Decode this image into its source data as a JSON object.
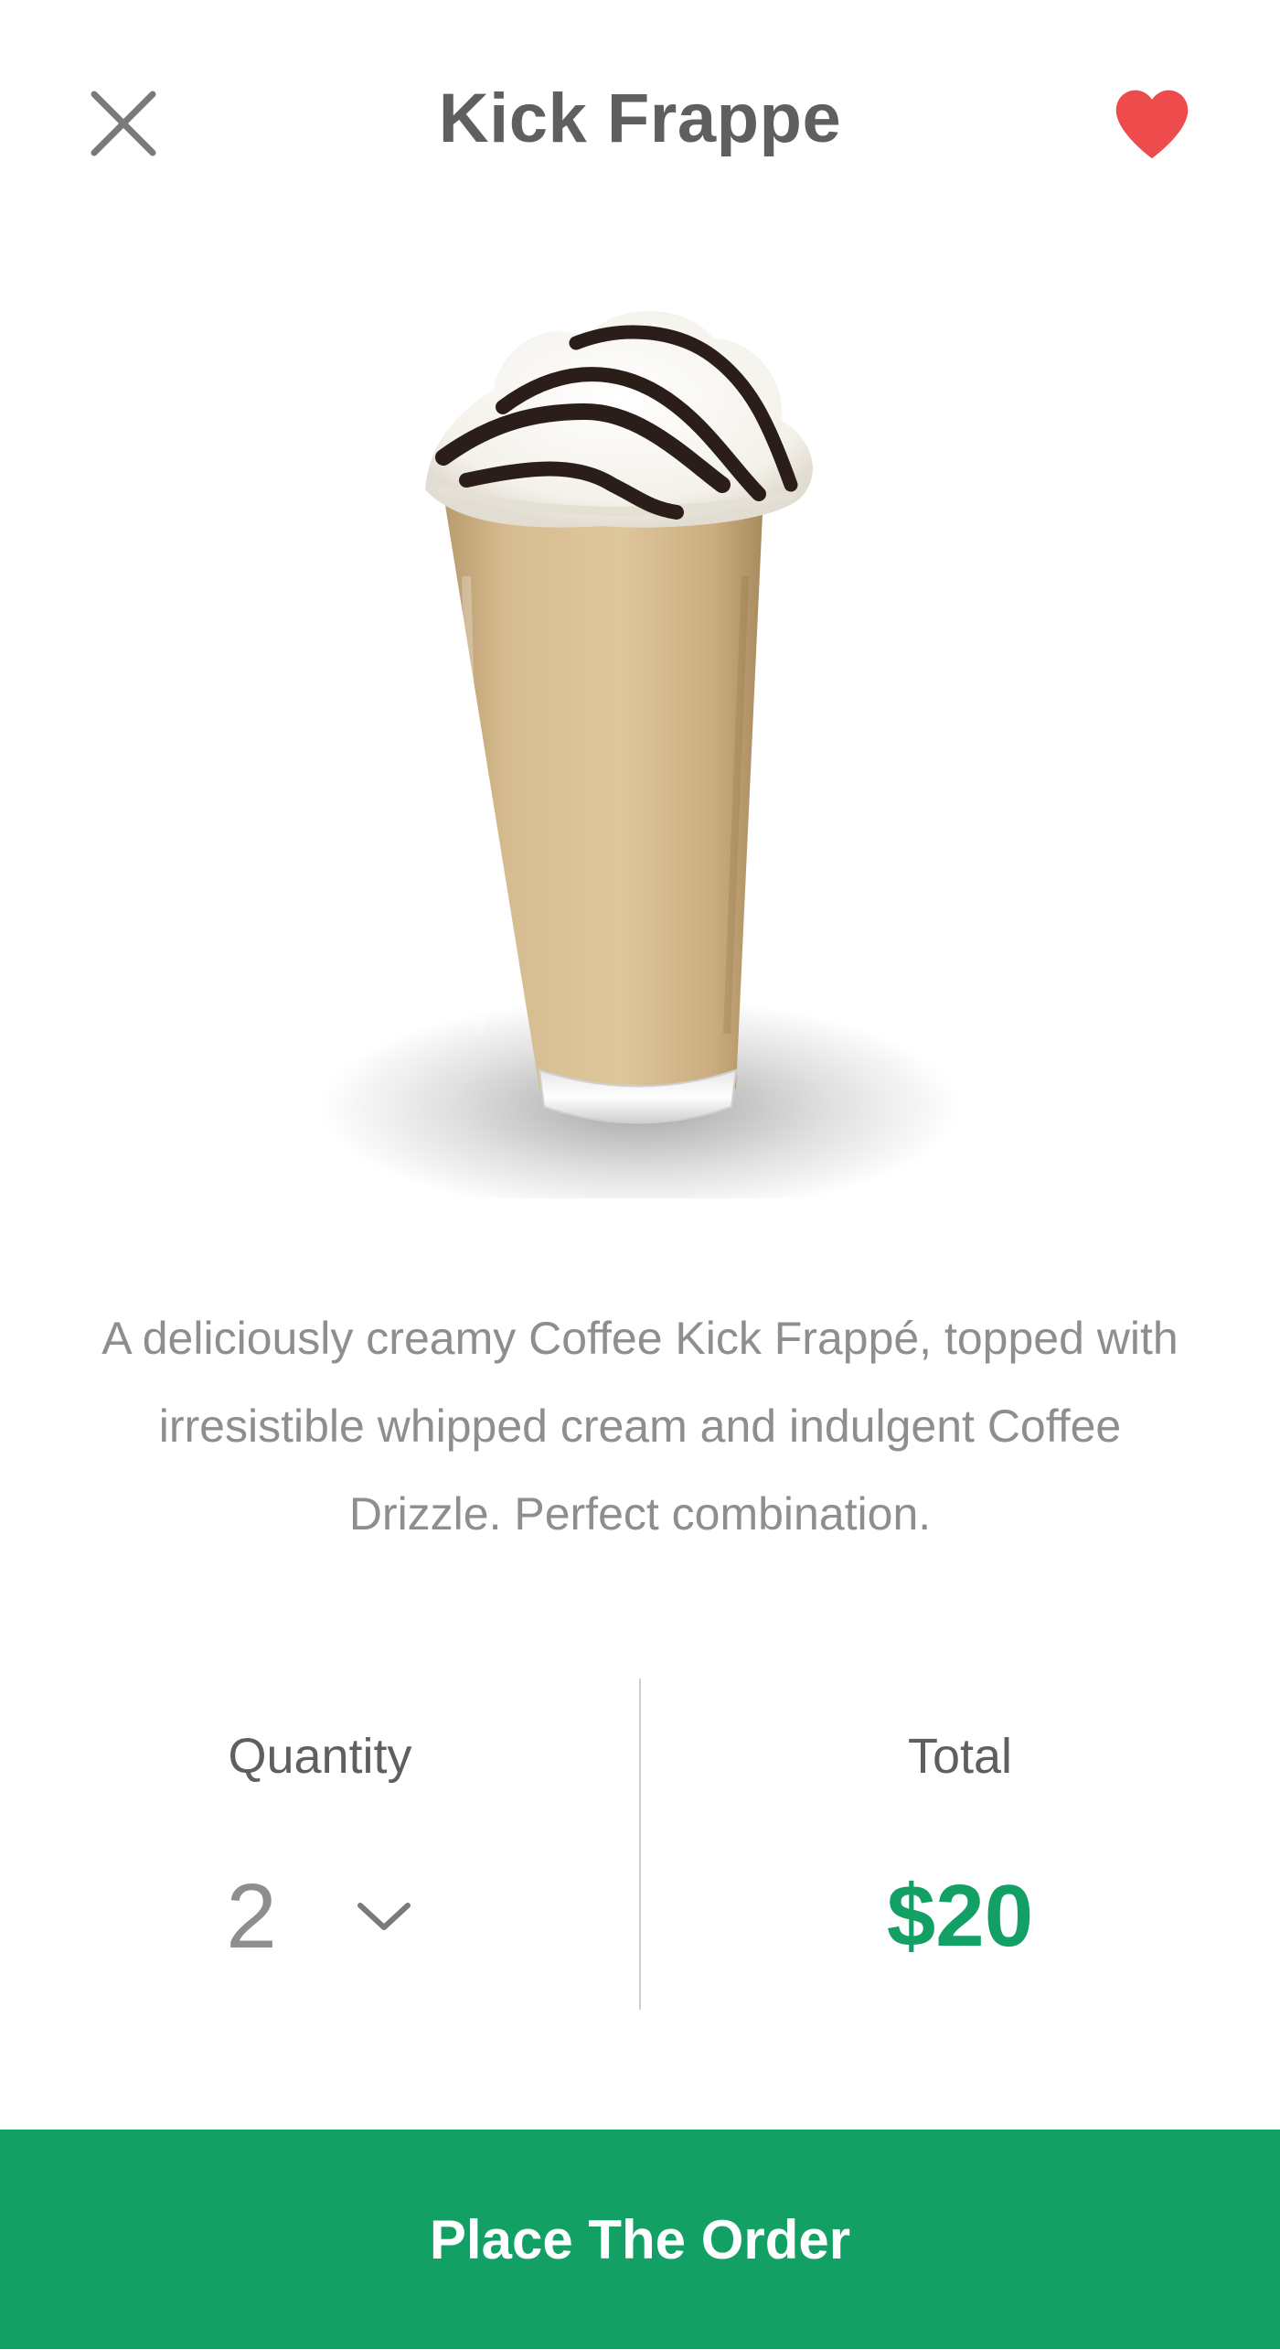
{
  "header": {
    "title": "Kick Frappe",
    "close_icon": "close-icon",
    "favorite_icon": "heart-icon",
    "favorite_color": "#ee4c4c"
  },
  "product": {
    "image": "frappe-drink-photo",
    "description": "A deliciously creamy Coffee Kick Frappé, topped with irresistible whipped cream and indulgent Coffee Drizzle. Perfect combination."
  },
  "order": {
    "quantity_label": "Quantity",
    "quantity_value": "2",
    "quantity_icon": "chevron-down-icon",
    "total_label": "Total",
    "total_value": "$20"
  },
  "footer": {
    "button_label": "Place The Order"
  },
  "colors": {
    "accent": "#13a065",
    "title_text": "#5f5f5f",
    "body_text": "#8e8e8e",
    "favorite": "#ee4c4c"
  }
}
